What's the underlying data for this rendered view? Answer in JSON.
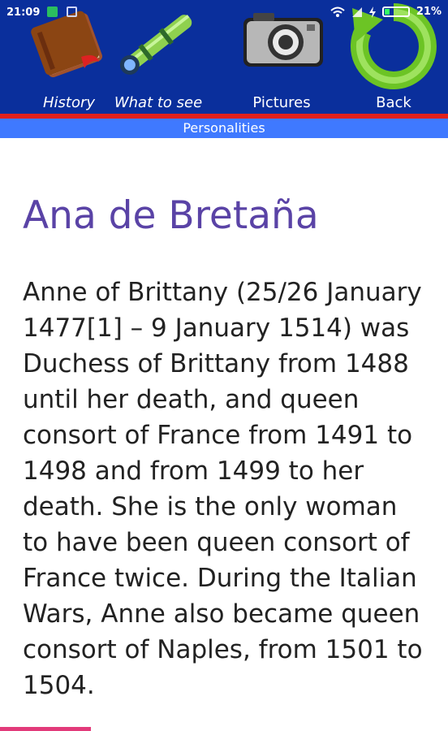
{
  "status": {
    "time": "21:09",
    "battery": "21%",
    "battery_level": 0.21,
    "icons": [
      "shield-icon",
      "gallery-icon",
      "wifi-icon",
      "signal-icon",
      "charging-icon",
      "battery-icon"
    ]
  },
  "nav": {
    "items": [
      {
        "label": "History",
        "icon": "book-icon"
      },
      {
        "label": "What to see",
        "icon": "telescope-icon"
      },
      {
        "label": "Pictures",
        "icon": "camera-icon"
      },
      {
        "label": "Back",
        "icon": "back-arrow-icon"
      }
    ]
  },
  "subnav": {
    "label": "Personalities"
  },
  "article": {
    "title": "Ana de Bretaña",
    "body": "Anne of Brittany (25/26 January 1477[1] – 9 January 1514) was Duchess of Brittany from 1488 until her death, and queen consort of France from 1491 to 1498 and from 1499 to her death. She is the only woman to have been queen consort of France twice. During the Italian Wars, Anne also became queen consort of Naples, from 1501 to 1504."
  },
  "colors": {
    "header": "#0a2f9c",
    "subnav": "#3f79ff",
    "title": "#5a43a6",
    "accent_red": "#e0201c"
  }
}
